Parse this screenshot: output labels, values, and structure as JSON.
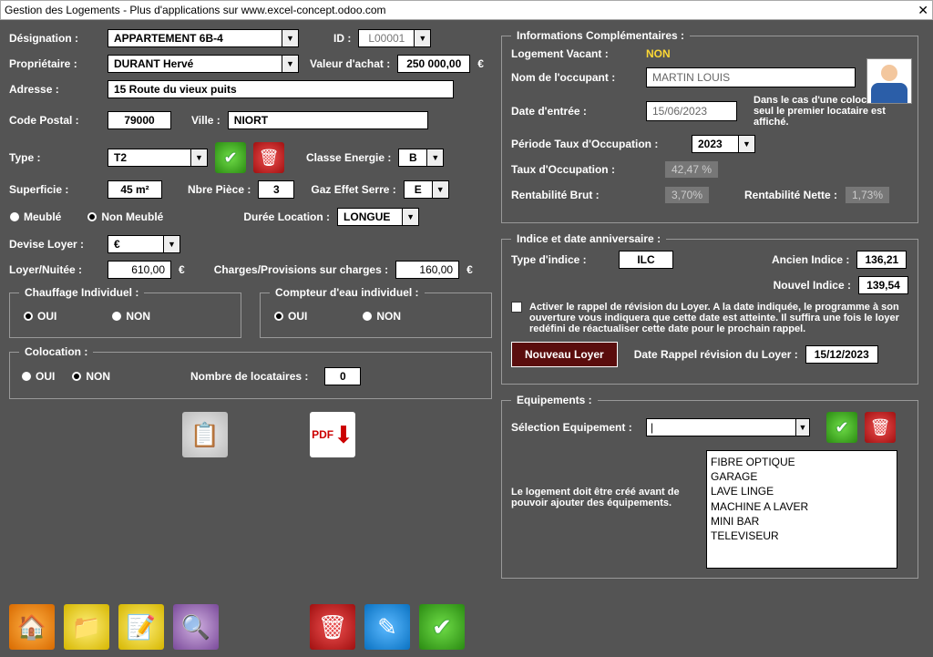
{
  "window": {
    "title": "Gestion des Logements   - Plus d'applications sur www.excel-concept.odoo.com"
  },
  "left": {
    "designation_label": "Désignation :",
    "designation": "APPARTEMENT 6B-4",
    "id_label": "ID :",
    "id": "L00001",
    "owner_label": "Propriétaire :",
    "owner": "DURANT Hervé",
    "purchase_label": "Valeur d'achat :",
    "purchase": "250 000,00",
    "currency_sym": "€",
    "address_label": "Adresse :",
    "address": "15 Route du vieux puits",
    "postal_label": "Code Postal :",
    "postal": "79000",
    "city_label": "Ville :",
    "city": "NIORT",
    "type_label": "Type :",
    "type": "T2",
    "energy_label": "Classe Energie :",
    "energy": "B",
    "area_label": "Superficie :",
    "area": "45 m²",
    "rooms_label": "Nbre Pièce :",
    "rooms": "3",
    "gas_label": "Gaz Effet Serre :",
    "gas": "E",
    "furnished": "Meublé",
    "unfurnished": "Non Meublé",
    "duration_label": "Durée Location :",
    "duration": "LONGUE",
    "currency_label": "Devise Loyer :",
    "currency": "€",
    "rent_label": "Loyer/Nuitée :",
    "rent": "610,00",
    "charges_label": "Charges/Provisions sur charges :",
    "charges": "160,00",
    "heating_legend": "Chauffage Individuel :",
    "water_legend": "Compteur d'eau individuel :",
    "coloc_legend": "Colocation :",
    "tenants_label": "Nombre de locataires :",
    "tenants": "0",
    "oui": "OUI",
    "non": "NON"
  },
  "info": {
    "legend": "Informations Complémentaires :",
    "vacant_label": "Logement Vacant :",
    "vacant": "NON",
    "occupant_label": "Nom de l'occupant :",
    "occupant": "MARTIN LOUIS",
    "entry_label": "Date d'entrée :",
    "entry": "15/06/2023",
    "coloc_note": "Dans le cas d'une colocation seul le premier locataire est affiché.",
    "occperiod_label": "Période Taux d'Occupation :",
    "occperiod": "2023",
    "occrate_label": "Taux d'Occupation :",
    "occrate": "42,47 %",
    "gross_label": "Rentabilité Brut :",
    "gross": "3,70%",
    "net_label": "Rentabilité Nette :",
    "net": "1,73%"
  },
  "index": {
    "legend": "Indice et date anniversaire :",
    "type_label": "Type d'indice :",
    "type": "ILC",
    "old_label": "Ancien Indice :",
    "old": "136,21",
    "new_label": "Nouvel Indice :",
    "new": "139,54",
    "reminder_text": "Activer le rappel de révision du Loyer. A la date indiquée, le programme à son ouverture vous indiquera que cette date est atteinte. Il suffira une fois le loyer redéfini de réactualiser cette date pour le prochain rappel.",
    "new_rent_btn": "Nouveau Loyer",
    "reminder_label": "Date Rappel révision du Loyer :",
    "reminder_date": "15/12/2023"
  },
  "equip": {
    "legend": "Equipements :",
    "select_label": "Sélection Equipement :",
    "note": "Le logement doit être créé avant de pouvoir ajouter des équipements.",
    "items": [
      "FIBRE OPTIQUE",
      "GARAGE",
      "LAVE LINGE",
      "MACHINE A LAVER",
      "MINI BAR",
      "TELEVISEUR"
    ]
  }
}
